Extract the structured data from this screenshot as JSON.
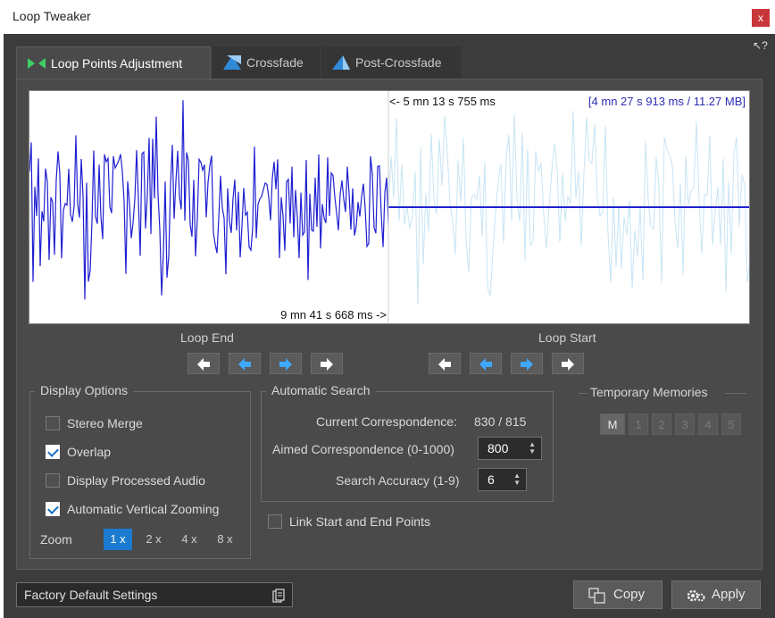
{
  "window": {
    "title": "Loop Tweaker",
    "close_label": "x",
    "help_label": "?"
  },
  "tabs": [
    {
      "label": "Loop Points Adjustment",
      "icon": "loop-points-icon",
      "active": true
    },
    {
      "label": "Crossfade",
      "icon": "crossfade-icon",
      "active": false
    },
    {
      "label": "Post-Crossfade",
      "icon": "post-crossfade-icon",
      "active": false
    }
  ],
  "waveform": {
    "offset_left": "<- 5 mn 13 s 755 ms",
    "total": "[4 mn 27 s 913 ms / 11.27 MB]",
    "position_bottom": "9 mn 41 s 668 ms ->",
    "colors": {
      "left": "#1f1fd2",
      "right": "#c8e4f4",
      "line": "#1f1fd2"
    }
  },
  "loop_end": {
    "label": "Loop End",
    "buttons": [
      "arrow-left-white-icon",
      "arrow-left-blue-icon",
      "arrow-right-blue-icon",
      "arrow-right-white-icon"
    ]
  },
  "loop_start": {
    "label": "Loop Start",
    "buttons": [
      "arrow-left-white-icon",
      "arrow-left-blue-icon",
      "arrow-right-blue-icon",
      "arrow-right-white-icon"
    ]
  },
  "display_options": {
    "title": "Display Options",
    "items": [
      {
        "label": "Stereo Merge",
        "checked": false
      },
      {
        "label": "Overlap",
        "checked": true
      },
      {
        "label": "Display Processed Audio",
        "checked": false
      },
      {
        "label": "Automatic Vertical Zooming",
        "checked": true
      }
    ],
    "zoom_label": "Zoom",
    "zoom_options": [
      "1 x",
      "2 x",
      "4 x",
      "8 x"
    ],
    "zoom_selected": "1 x"
  },
  "automatic_search": {
    "title": "Automatic Search",
    "current_label": "Current Correspondence:",
    "current_value": "830 / 815",
    "aimed_label": "Aimed Correspondence (0-1000)",
    "aimed_value": "800",
    "accuracy_label": "Search Accuracy (1-9)",
    "accuracy_value": "6"
  },
  "link_points": {
    "label": "Link Start and End Points",
    "checked": false
  },
  "temporary_memories": {
    "title": "Temporary Memories",
    "slots": [
      "M",
      "1",
      "2",
      "3",
      "4",
      "5"
    ]
  },
  "footer": {
    "preset": "Factory Default Settings",
    "copy_label": "Copy",
    "apply_label": "Apply"
  }
}
